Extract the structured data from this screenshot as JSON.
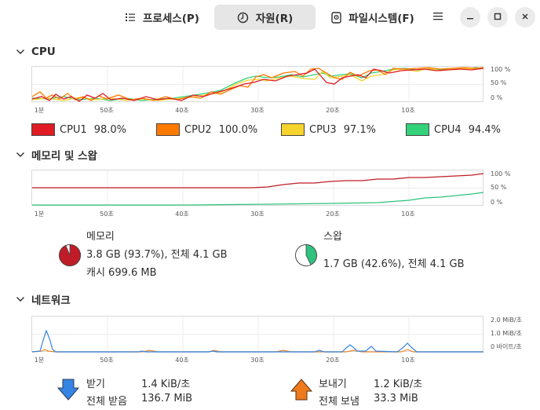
{
  "tabs": [
    {
      "label": "프로세스(P)",
      "icon": "list-icon"
    },
    {
      "label": "자원(R)",
      "icon": "clock-icon",
      "active": true
    },
    {
      "label": "파일시스템(F)",
      "icon": "disk-icon"
    }
  ],
  "window_controls": {
    "menu": "menu-icon",
    "minimize": "minimize-icon",
    "maximize": "maximize-icon",
    "close": "close-icon"
  },
  "time_axis": [
    "1분",
    "50초",
    "40초",
    "30초",
    "20초",
    "10초"
  ],
  "cpu": {
    "title": "CPU",
    "y_ticks": [
      "100 %",
      "50 %",
      "0 %"
    ],
    "legend": [
      {
        "name": "CPU1",
        "value": "98.0%",
        "color": "#e01b24"
      },
      {
        "name": "CPU2",
        "value": "100.0%",
        "color": "#ff7800"
      },
      {
        "name": "CPU3",
        "value": "97.1%",
        "color": "#f6d32d"
      },
      {
        "name": "CPU4",
        "value": "94.4%",
        "color": "#33d17a"
      }
    ]
  },
  "memory": {
    "title": "메모리 및 스왑",
    "y_ticks": [
      "100 %",
      "50 %",
      "0 %"
    ],
    "mem_label": "메모리",
    "mem_usage": "3.8 GB (93.7%), 전체 4.1 GB",
    "mem_cache": "캐시 699.6 MB",
    "mem_fraction": 0.937,
    "mem_color": "#c01c28",
    "swap_label": "스왑",
    "swap_usage": "1.7 GB (42.6%), 전체 4.1 GB",
    "swap_fraction": 0.426,
    "swap_color": "#2ec27e"
  },
  "network": {
    "title": "네트워크",
    "y_ticks": [
      "2.0 MiB/초",
      "1.0 MiB/초",
      "0 바이트/초"
    ],
    "recv_label": "받기",
    "recv_rate": "1.4 KiB/초",
    "recv_total_label": "전체 받음",
    "recv_total": "136.7 MiB",
    "recv_color": "#3584e4",
    "send_label": "보내기",
    "send_rate": "1.2 KiB/초",
    "send_total_label": "전체 보냄",
    "send_total": "33.3 MiB",
    "send_color": "#ed8a2c"
  }
}
